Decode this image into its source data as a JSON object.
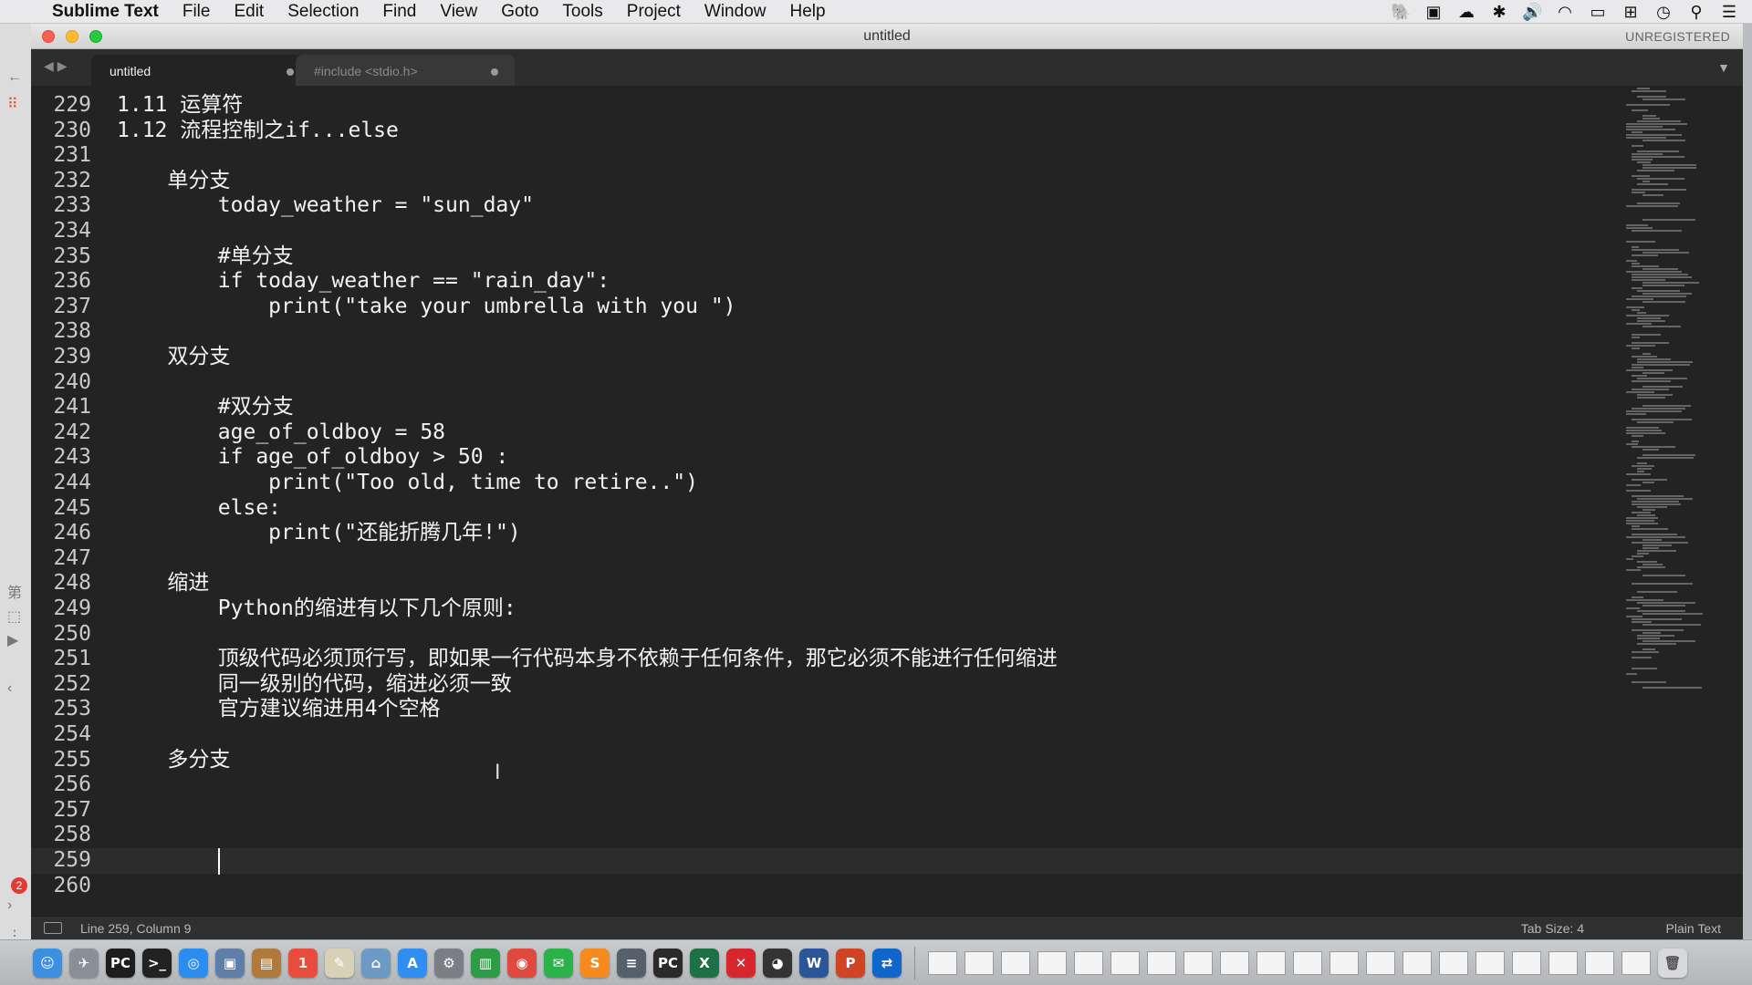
{
  "menubar": {
    "app_name": "Sublime Text",
    "items": [
      "File",
      "Edit",
      "Selection",
      "Find",
      "View",
      "Goto",
      "Tools",
      "Project",
      "Window",
      "Help"
    ],
    "status_icons": [
      "evernote-icon",
      "screen-record-icon",
      "cloud-icon",
      "bluetooth-icon",
      "volume-icon",
      "wifi-icon",
      "battery-icon",
      "input-method-icon",
      "clock-icon",
      "search-icon",
      "menu-list-icon"
    ]
  },
  "window": {
    "title": "untitled",
    "registration": "UNREGISTERED"
  },
  "tabs": [
    {
      "label": "untitled",
      "active": true
    },
    {
      "label": "#include <stdio.h>",
      "active": false
    }
  ],
  "editor": {
    "lines": [
      {
        "n": "229",
        "text": "1.11 运算符"
      },
      {
        "n": "230",
        "text": "1.12 流程控制之if...else"
      },
      {
        "n": "231",
        "text": ""
      },
      {
        "n": "232",
        "text": "    单分支"
      },
      {
        "n": "233",
        "text": "        today_weather = \"sun_day\""
      },
      {
        "n": "234",
        "text": ""
      },
      {
        "n": "235",
        "text": "        #单分支"
      },
      {
        "n": "236",
        "text": "        if today_weather == \"rain_day\":"
      },
      {
        "n": "237",
        "text": "            print(\"take your umbrella with you \")"
      },
      {
        "n": "238",
        "text": ""
      },
      {
        "n": "239",
        "text": "    双分支"
      },
      {
        "n": "240",
        "text": ""
      },
      {
        "n": "241",
        "text": "        #双分支"
      },
      {
        "n": "242",
        "text": "        age_of_oldboy = 58"
      },
      {
        "n": "243",
        "text": "        if age_of_oldboy > 50 :"
      },
      {
        "n": "244",
        "text": "            print(\"Too old, time to retire..\")"
      },
      {
        "n": "245",
        "text": "        else:"
      },
      {
        "n": "246",
        "text": "            print(\"还能折腾几年!\")"
      },
      {
        "n": "247",
        "text": ""
      },
      {
        "n": "248",
        "text": "    缩进"
      },
      {
        "n": "249",
        "text": "        Python的缩进有以下几个原则:"
      },
      {
        "n": "250",
        "text": ""
      },
      {
        "n": "251",
        "text": "        顶级代码必须顶行写，即如果一行代码本身不依赖于任何条件，那它必须不能进行任何缩进"
      },
      {
        "n": "252",
        "text": "        同一级别的代码，缩进必须一致"
      },
      {
        "n": "253",
        "text": "        官方建议缩进用4个空格"
      },
      {
        "n": "254",
        "text": ""
      },
      {
        "n": "255",
        "text": "    多分支"
      },
      {
        "n": "256",
        "text": ""
      },
      {
        "n": "257",
        "text": ""
      },
      {
        "n": "258",
        "text": ""
      },
      {
        "n": "259",
        "text": ""
      },
      {
        "n": "260",
        "text": ""
      }
    ]
  },
  "statusbar": {
    "position": "Line 259, Column 9",
    "tab_size": "Tab Size: 4",
    "syntax": "Plain Text"
  },
  "left_strip": {
    "badge": "2"
  },
  "dock": {
    "apps": [
      {
        "name": "finder-icon",
        "glyph": "☺",
        "color": "#3d8fe0"
      },
      {
        "name": "launchpad-icon",
        "glyph": "✈",
        "color": "#8a8f96"
      },
      {
        "name": "pycharm-icon",
        "glyph": "PC",
        "color": "#1d1d1d"
      },
      {
        "name": "terminal-icon",
        "glyph": ">_",
        "color": "#222222"
      },
      {
        "name": "safari-icon",
        "glyph": "◎",
        "color": "#2c8df0"
      },
      {
        "name": "preview-icon",
        "glyph": "▣",
        "color": "#5d7fa8"
      },
      {
        "name": "notebook-icon",
        "glyph": "▤",
        "color": "#b07a3c"
      },
      {
        "name": "calendar-icon",
        "glyph": "1",
        "color": "#e84c3d"
      },
      {
        "name": "textedit-icon",
        "glyph": "✎",
        "color": "#d9d0b8"
      },
      {
        "name": "network-icon",
        "glyph": "⌂",
        "color": "#6d9ac4"
      },
      {
        "name": "app-store-icon",
        "glyph": "A",
        "color": "#2e8ef2"
      },
      {
        "name": "system-preferences-icon",
        "glyph": "⚙",
        "color": "#7b7f85"
      },
      {
        "name": "numbers-icon",
        "glyph": "▥",
        "color": "#2e9b45"
      },
      {
        "name": "chrome-icon",
        "glyph": "◉",
        "color": "#e0493e"
      },
      {
        "name": "wechat-icon",
        "glyph": "✉",
        "color": "#2bb24c"
      },
      {
        "name": "sublime-text-icon",
        "glyph": "S",
        "color": "#f58b1f"
      },
      {
        "name": "scanner-icon",
        "glyph": "≡",
        "color": "#55606b"
      },
      {
        "name": "pycharm-icon-2",
        "glyph": "PC",
        "color": "#2a2a2a"
      },
      {
        "name": "excel-icon",
        "glyph": "X",
        "color": "#1e7145"
      },
      {
        "name": "xmind-icon",
        "glyph": "✕",
        "color": "#d8262e"
      },
      {
        "name": "qq-icon",
        "glyph": "◕",
        "color": "#333333"
      },
      {
        "name": "word-icon",
        "glyph": "W",
        "color": "#2b579a"
      },
      {
        "name": "powerpoint-icon",
        "glyph": "P",
        "color": "#d04423"
      },
      {
        "name": "teamviewer-icon",
        "glyph": "⇄",
        "color": "#1166cc"
      }
    ],
    "thumbnails": 20
  }
}
